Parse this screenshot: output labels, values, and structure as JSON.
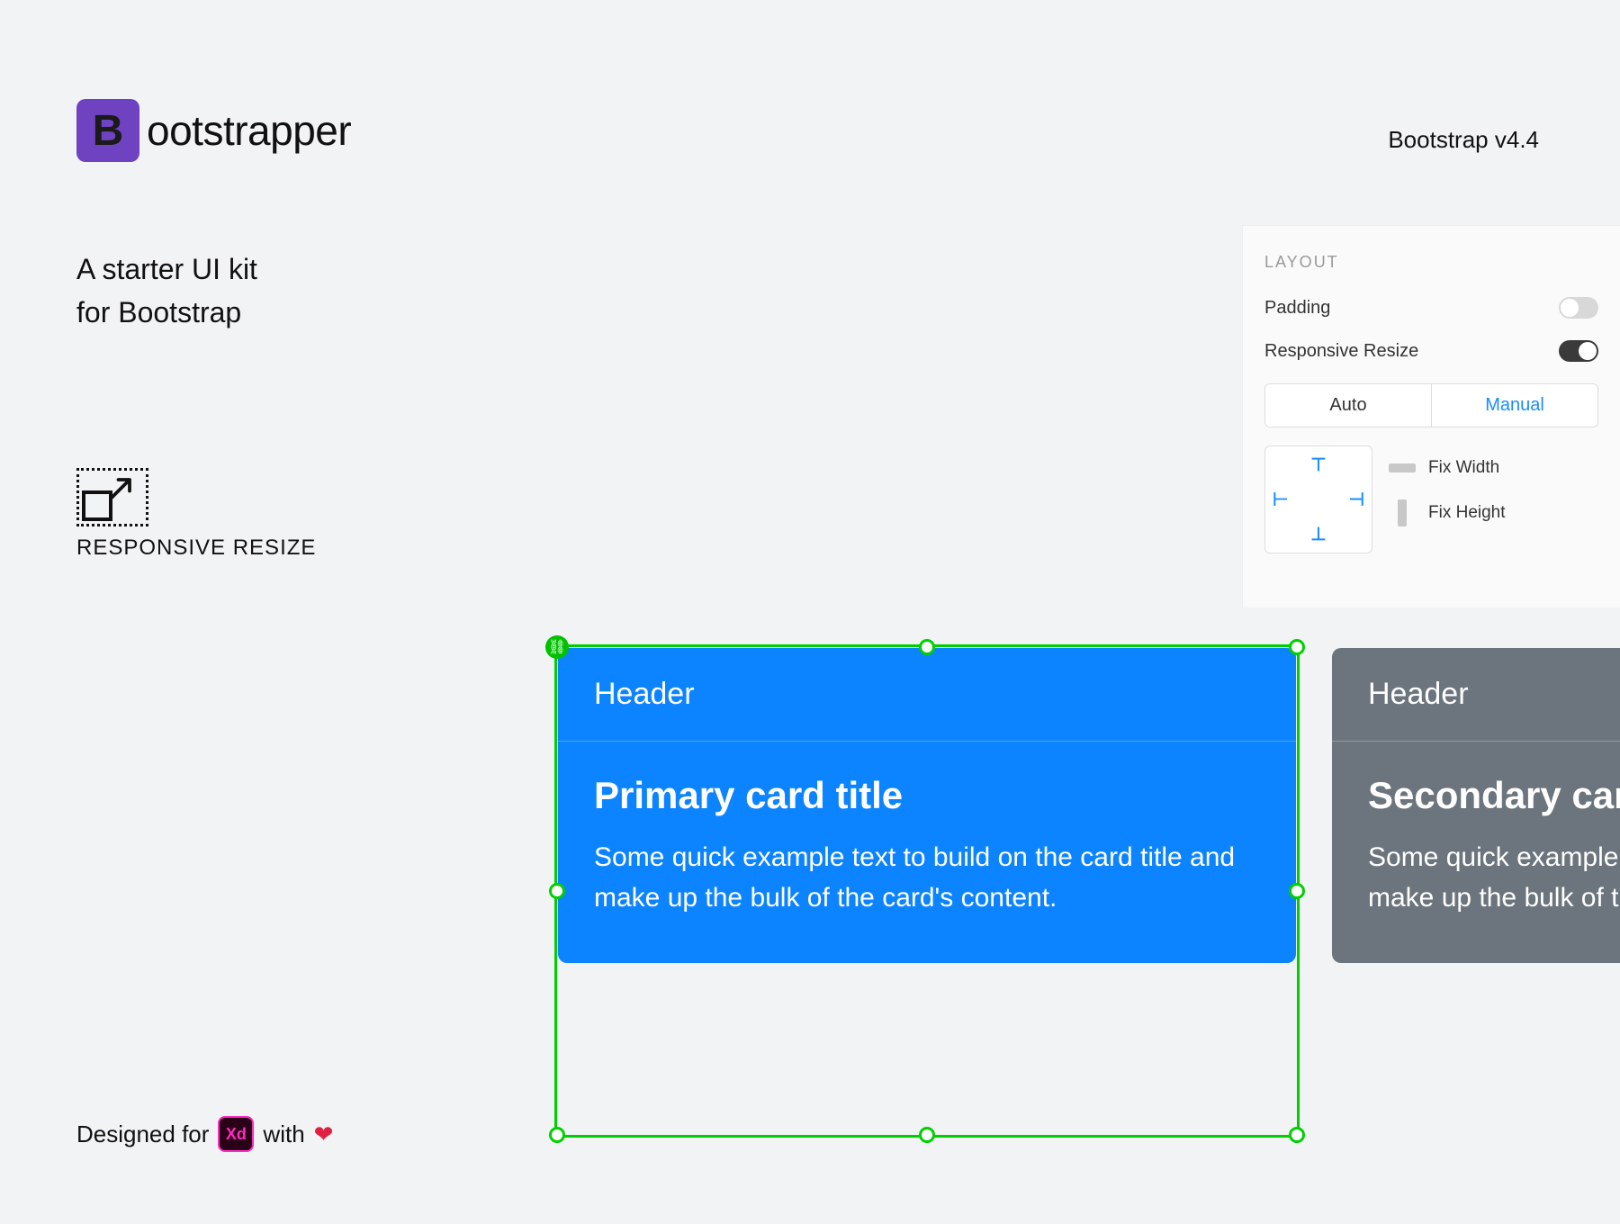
{
  "header": {
    "logo_letter": "B",
    "logo_text": "ootstrapper",
    "version": "Bootstrap v4.4"
  },
  "tagline": {
    "line1": "A starter UI kit",
    "line2": "for Bootstrap"
  },
  "resize_feature": {
    "label": "RESPONSIVE RESIZE"
  },
  "layout_panel": {
    "heading": "LAYOUT",
    "padding_label": "Padding",
    "padding_on": false,
    "responsive_label": "Responsive Resize",
    "responsive_on": true,
    "seg_auto": "Auto",
    "seg_manual": "Manual",
    "seg_active": "Manual",
    "fix_width": "Fix Width",
    "fix_height": "Fix Height"
  },
  "cards": {
    "primary": {
      "header": "Header",
      "title": "Primary card title",
      "text": "Some quick example text to build on the card title and make up the bulk of the card's content."
    },
    "secondary": {
      "header": "Header",
      "title": "Secondary card title",
      "text": "Some quick example text to build on the card title and make up the bulk of the card's content."
    }
  },
  "footer": {
    "pre": "Designed for",
    "xd": "Xd",
    "mid": "with",
    "heart": "❤"
  }
}
